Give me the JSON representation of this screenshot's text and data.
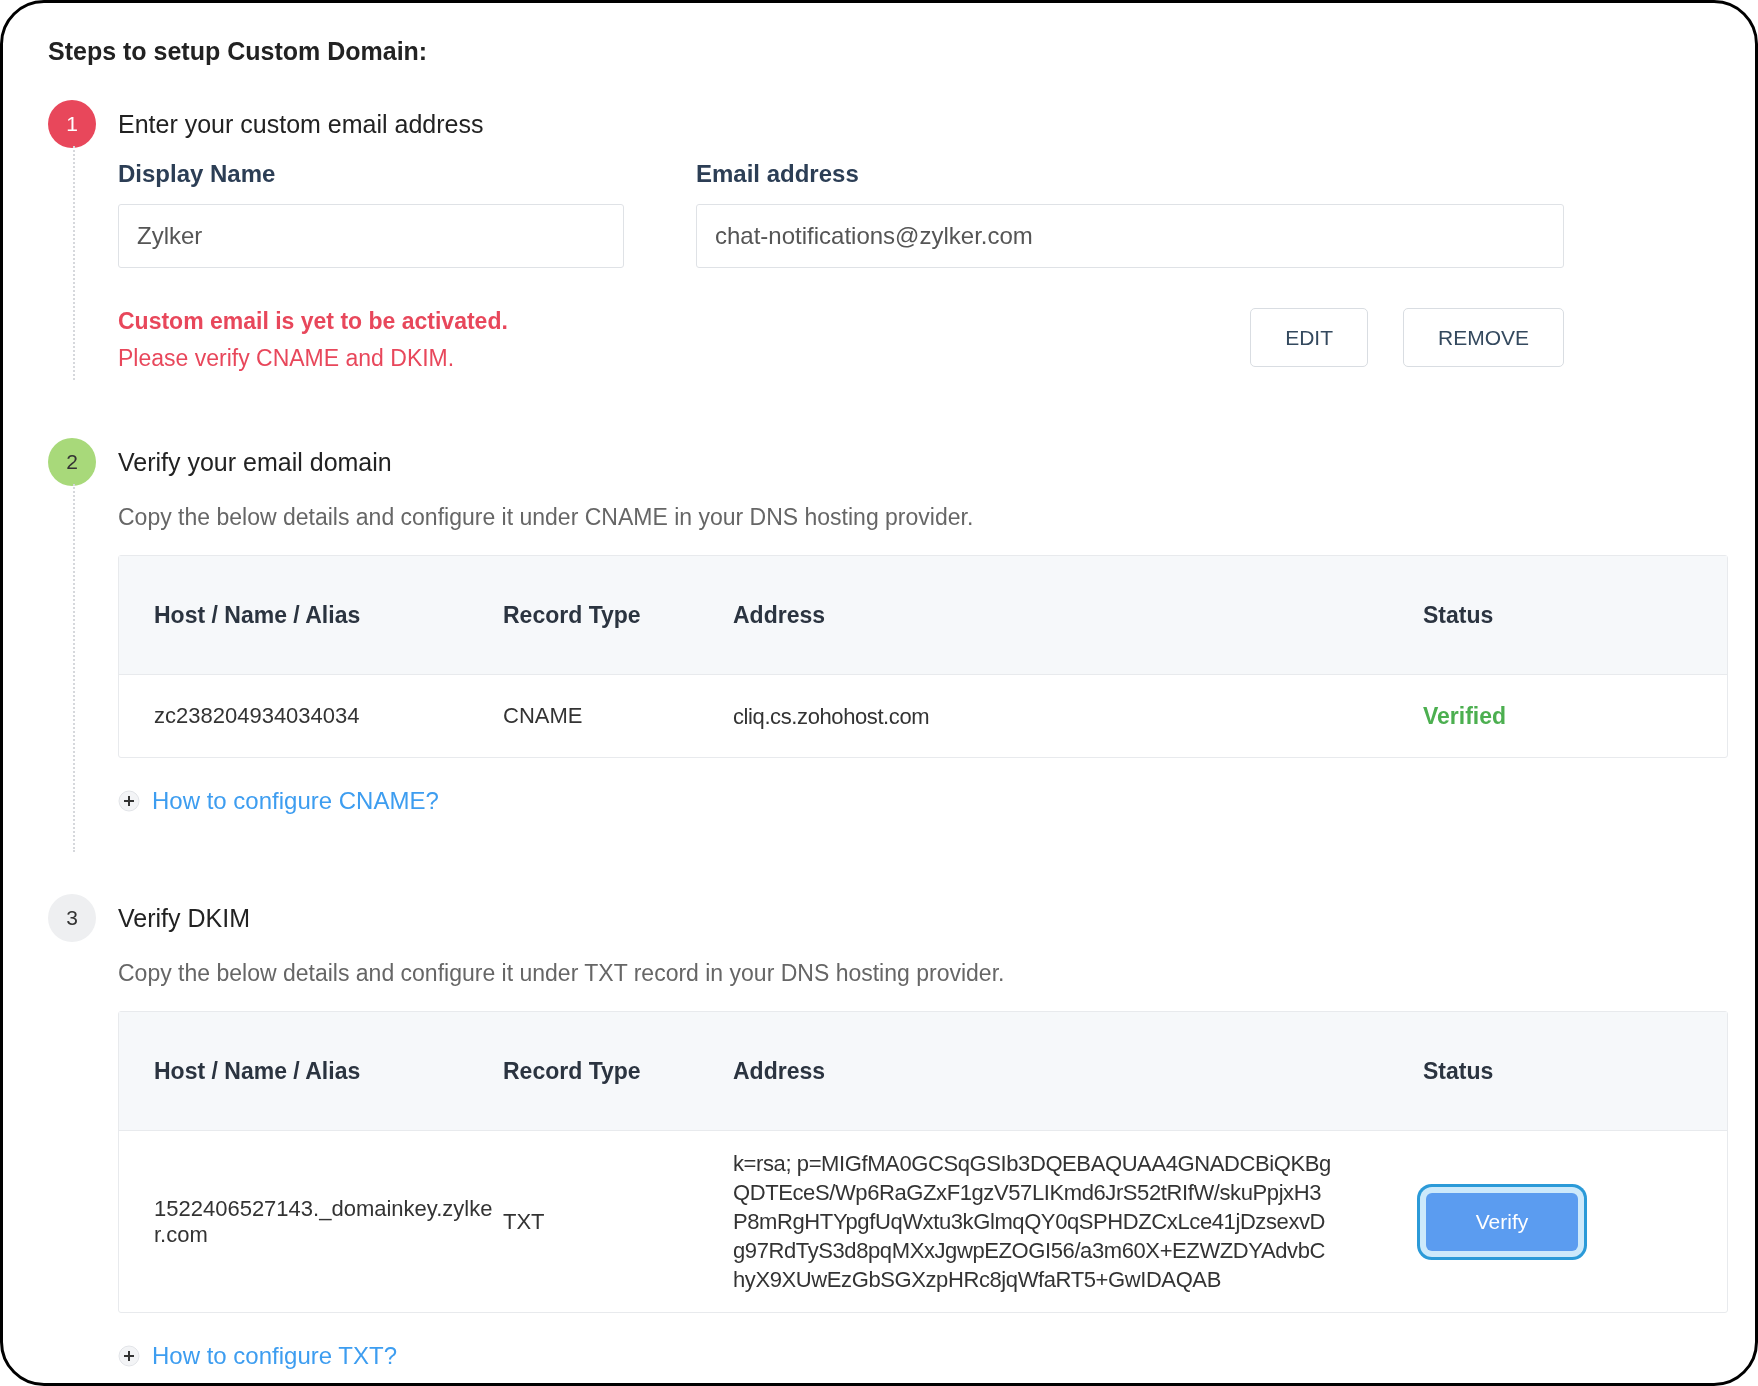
{
  "title": "Steps to setup Custom Domain:",
  "steps": [
    {
      "number": "1",
      "color": "#e8475b",
      "title": "Enter your custom email address",
      "fields": [
        {
          "label": "Display Name",
          "value": "Zylker"
        },
        {
          "label": "Email address",
          "value": "chat-notifications@zylker.com"
        }
      ],
      "alert": {
        "headline": "Custom email is yet to be activated.",
        "detail": "Please verify CNAME and DKIM."
      },
      "buttons": [
        "EDIT",
        "REMOVE"
      ]
    },
    {
      "number": "2",
      "color": "#a8d97a",
      "title": "Verify your email domain",
      "description": "Copy the below details and configure it under CNAME in your DNS hosting provider.",
      "table": {
        "columns": [
          "Host / Name / Alias",
          "Record Type",
          "Address",
          "Status"
        ],
        "rows": [
          {
            "host": "zc238204934034034",
            "record_type": "CNAME",
            "address_lines": [
              "cliq.cs.zohohost.com"
            ],
            "status": {
              "kind": "verified",
              "label": "Verified"
            }
          }
        ]
      },
      "help_link": "How to configure CNAME?"
    },
    {
      "number": "3",
      "color": "#eeeff1",
      "title": "Verify DKIM",
      "description": "Copy the below details and configure it under TXT record in your DNS hosting provider.",
      "table": {
        "columns": [
          "Host / Name / Alias",
          "Record Type",
          "Address",
          "Status"
        ],
        "rows": [
          {
            "host": "1522406527143._domainkey.zylker.com",
            "record_type": "TXT",
            "address_lines": [
              "k=rsa; p=MIGfMA0GCSqGSIb3DQEBAQUAA4GNADCBiQKBg",
              "QDTEceS/Wp6RaGZxF1gzV57LIKmd6JrS52tRIfW/skuPpjxH3",
              "P8mRgHTYpgfUqWxtu3kGlmqQY0qSPHDZCxLce41jDzsexvD",
              "g97RdTyS3d8pqMXxJgwpEZOGI56/a3m60X+EZWZDYAdvbC",
              "hyX9XUwEzGbSGXzpHRc8jqWfaRT5+GwIDAQAB"
            ],
            "status": {
              "kind": "button",
              "label": "Verify",
              "focused": true
            }
          }
        ]
      },
      "help_link": "How to configure TXT?"
    }
  ]
}
